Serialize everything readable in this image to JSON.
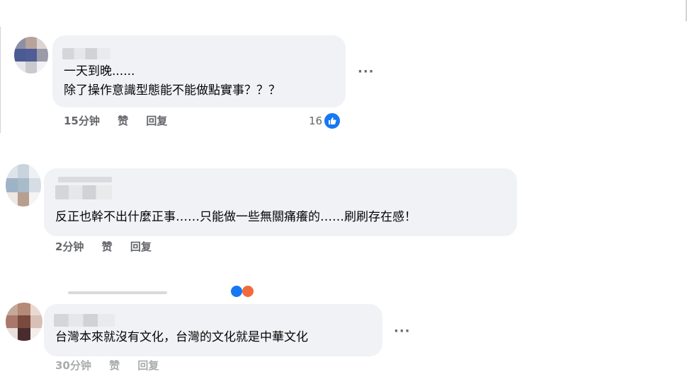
{
  "comments": [
    {
      "text": "一天到晚......\n除了操作意識型態能不能做點實事？？？",
      "time": "15分钟",
      "like_label": "赞",
      "reply_label": "回复",
      "reaction_count": "16",
      "more": "···"
    },
    {
      "text": "反正也幹不出什麼正事……只能做一些無關痛癢的……刷刷存在感！",
      "time": "2分钟",
      "like_label": "赞",
      "reply_label": "回复",
      "more": ""
    },
    {
      "text": "台灣本來就沒有文化，台灣的文化就是中華文化",
      "time": "30分钟",
      "like_label": "赞",
      "reply_label": "回复",
      "more": "···"
    }
  ],
  "colors": {
    "bubble": "#f0f2f5",
    "like_blue": "#1877f2",
    "meta_gray": "#65676b"
  },
  "icons": {
    "like_badge": "thumbs-up-icon",
    "more": "ellipsis-icon"
  }
}
